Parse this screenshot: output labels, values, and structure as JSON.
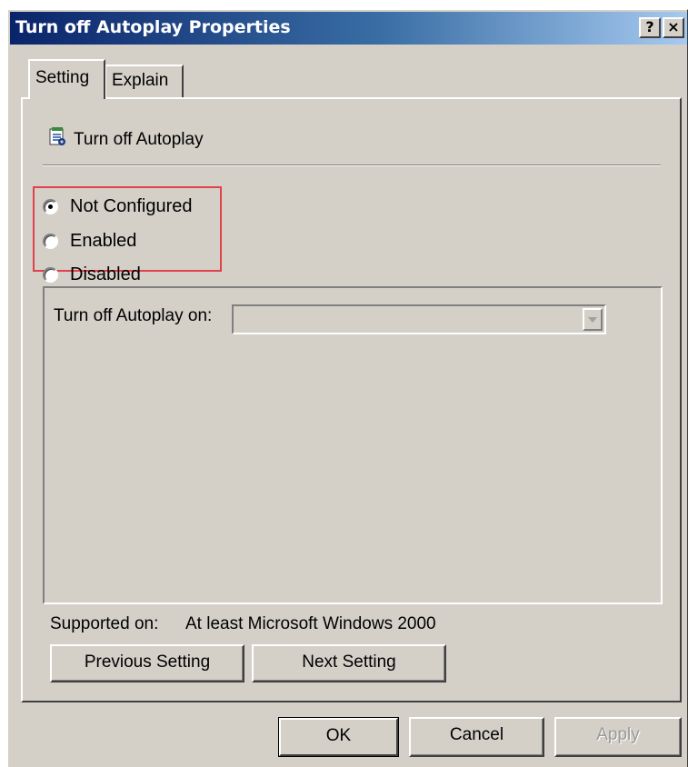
{
  "window": {
    "title": "Turn off Autoplay Properties",
    "help_button": "?",
    "close_button": "×"
  },
  "tabs": [
    {
      "label": "Setting",
      "active": true
    },
    {
      "label": "Explain",
      "active": false
    }
  ],
  "policy": {
    "name": "Turn off Autoplay",
    "icon": "policy-setting-icon"
  },
  "options": [
    {
      "label": "Not Configured",
      "checked": true
    },
    {
      "label": "Enabled",
      "checked": false
    },
    {
      "label": "Disabled",
      "checked": false
    }
  ],
  "highlight_color": "#e0414a",
  "group": {
    "combo_label": "Turn off Autoplay on:",
    "combo_value": "",
    "combo_enabled": false
  },
  "supported": {
    "label": "Supported on:",
    "value": "At least Microsoft Windows 2000"
  },
  "nav_buttons": {
    "previous": "Previous Setting",
    "next": "Next Setting"
  },
  "dialog_buttons": {
    "ok": "OK",
    "cancel": "Cancel",
    "apply": "Apply",
    "apply_enabled": false
  }
}
